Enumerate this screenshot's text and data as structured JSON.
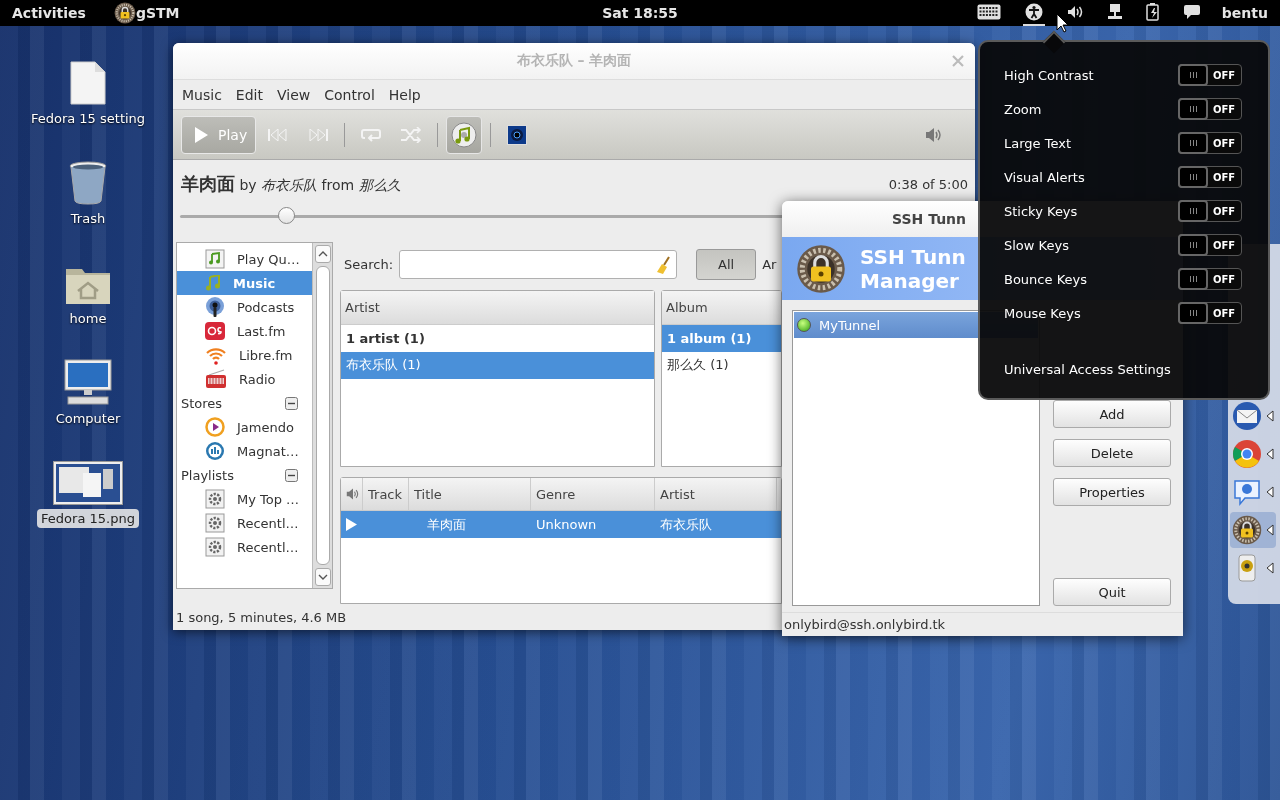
{
  "top_bar": {
    "activities": "Activities",
    "app_name": "gSTM",
    "clock": "Sat 18:55",
    "status_icons": [
      {
        "kind": "keyboard",
        "selected": false
      },
      {
        "kind": "accessibility",
        "selected": true
      },
      {
        "kind": "volume",
        "selected": false
      },
      {
        "kind": "network",
        "selected": false
      },
      {
        "kind": "battery",
        "selected": false
      },
      {
        "kind": "chat",
        "selected": false
      }
    ],
    "user": "bentu"
  },
  "desktop_icons": [
    {
      "kind": "file",
      "label": "Fedora 15 setting",
      "selected": false
    },
    {
      "kind": "trash",
      "label": "Trash",
      "selected": false
    },
    {
      "kind": "home",
      "label": "home",
      "selected": false
    },
    {
      "kind": "computer",
      "label": "Computer",
      "selected": false
    },
    {
      "kind": "image",
      "label": "Fedora 15.png",
      "selected": true
    }
  ],
  "music_window": {
    "title": "布衣乐队 – 羊肉面",
    "menu": [
      "Music",
      "Edit",
      "View",
      "Control",
      "Help"
    ],
    "toolbar": {
      "play_label": "Play",
      "buttons": [
        {
          "kind": "previous"
        },
        {
          "kind": "next"
        },
        {
          "kind": "separator"
        },
        {
          "kind": "repeat",
          "on": false
        },
        {
          "kind": "shuffle",
          "on": false
        },
        {
          "kind": "separator"
        },
        {
          "kind": "browse",
          "on": true
        },
        {
          "kind": "separator"
        },
        {
          "kind": "visualizer"
        }
      ]
    },
    "now_playing": {
      "text": "**羊肉面** by *布衣乐队* from *那么久*",
      "time": "0:38 of 5:00",
      "level": 0.176
    },
    "sidebar": {
      "items": [
        {
          "kind": "queue",
          "label": "Play Qu…",
          "selected": false
        },
        {
          "kind": "music",
          "label": "Music",
          "selected": true
        },
        {
          "kind": "podcast",
          "label": "Podcasts",
          "selected": false
        },
        {
          "kind": "lastfm",
          "label": "Last.fm",
          "selected": false
        },
        {
          "kind": "librefm",
          "label": "Libre.fm",
          "selected": false
        },
        {
          "kind": "radio",
          "label": "Radio",
          "selected": false
        },
        {
          "kind": "group",
          "label": "Stores",
          "expanded": true,
          "children": [
            {
              "kind": "jamendo",
              "label": "Jamendo",
              "selected": false
            },
            {
              "kind": "magnatune",
              "label": "Magnat…",
              "selected": false
            }
          ]
        },
        {
          "kind": "group",
          "label": "Playlists",
          "expanded": true,
          "children": [
            {
              "kind": "playlist",
              "label": "My Top …",
              "selected": false
            },
            {
              "kind": "playlist",
              "label": "Recentl…",
              "selected": false
            },
            {
              "kind": "playlist",
              "label": "Recentl…",
              "selected": false
            }
          ]
        }
      ]
    },
    "search": {
      "label": "Search:"
    },
    "filter_buttons": [
      {
        "label": "All",
        "selected": true
      },
      {
        "label": "Ar",
        "selected": false
      }
    ],
    "browsers": [
      {
        "header": "Artist",
        "rows": [
          {
            "kind": "all",
            "label": "1 artist (1)",
            "selected": false
          },
          {
            "kind": "entry",
            "label": "布衣乐队 (1)",
            "selected": true
          }
        ]
      },
      {
        "header": "Album",
        "rows": [
          {
            "kind": "all",
            "label": "1 album (1)",
            "selected": true
          },
          {
            "kind": "entry",
            "label": "那么久 (1)",
            "selected": false
          }
        ]
      }
    ],
    "track_list": {
      "columns": [
        "Track",
        "Title",
        "Genre",
        "Artist"
      ],
      "rows": [
        {
          "playing": true,
          "selected": true,
          "title": "羊肉面",
          "genre": "Unknown",
          "artist": "布衣乐队"
        }
      ]
    },
    "status": "1 song, 5 minutes, 4.6 MB"
  },
  "ssh_window": {
    "title": "SSH Tunn",
    "header": [
      "SSH Tunn",
      "Manager"
    ],
    "tunnels": [
      {
        "name": "MyTunnel",
        "active": true,
        "selected": true
      }
    ],
    "buttons": [
      "Add",
      "Delete",
      "Properties"
    ],
    "quit": "Quit",
    "status": "onlybird@ssh.onlybird.tk"
  },
  "accessibility_menu": {
    "items": [
      {
        "label": "High Contrast",
        "on": false,
        "state_label": "OFF"
      },
      {
        "label": "Zoom",
        "on": false,
        "state_label": "OFF"
      },
      {
        "label": "Large Text",
        "on": false,
        "state_label": "OFF"
      },
      {
        "label": "Visual Alerts",
        "on": false,
        "state_label": "OFF"
      },
      {
        "label": "Sticky Keys",
        "on": false,
        "state_label": "OFF"
      },
      {
        "label": "Slow Keys",
        "on": false,
        "state_label": "OFF"
      },
      {
        "label": "Bounce Keys",
        "on": false,
        "state_label": "OFF"
      },
      {
        "label": "Mouse Keys",
        "on": false,
        "state_label": "OFF"
      }
    ],
    "settings": "Universal Access Settings"
  },
  "dock": [
    {
      "kind": "mail",
      "running": true,
      "selected": false
    },
    {
      "kind": "browser",
      "running": true,
      "selected": false
    },
    {
      "kind": "chat",
      "running": true,
      "selected": false
    },
    {
      "kind": "tunnel",
      "running": true,
      "selected": true
    },
    {
      "kind": "speaker",
      "running": true,
      "selected": false
    }
  ]
}
